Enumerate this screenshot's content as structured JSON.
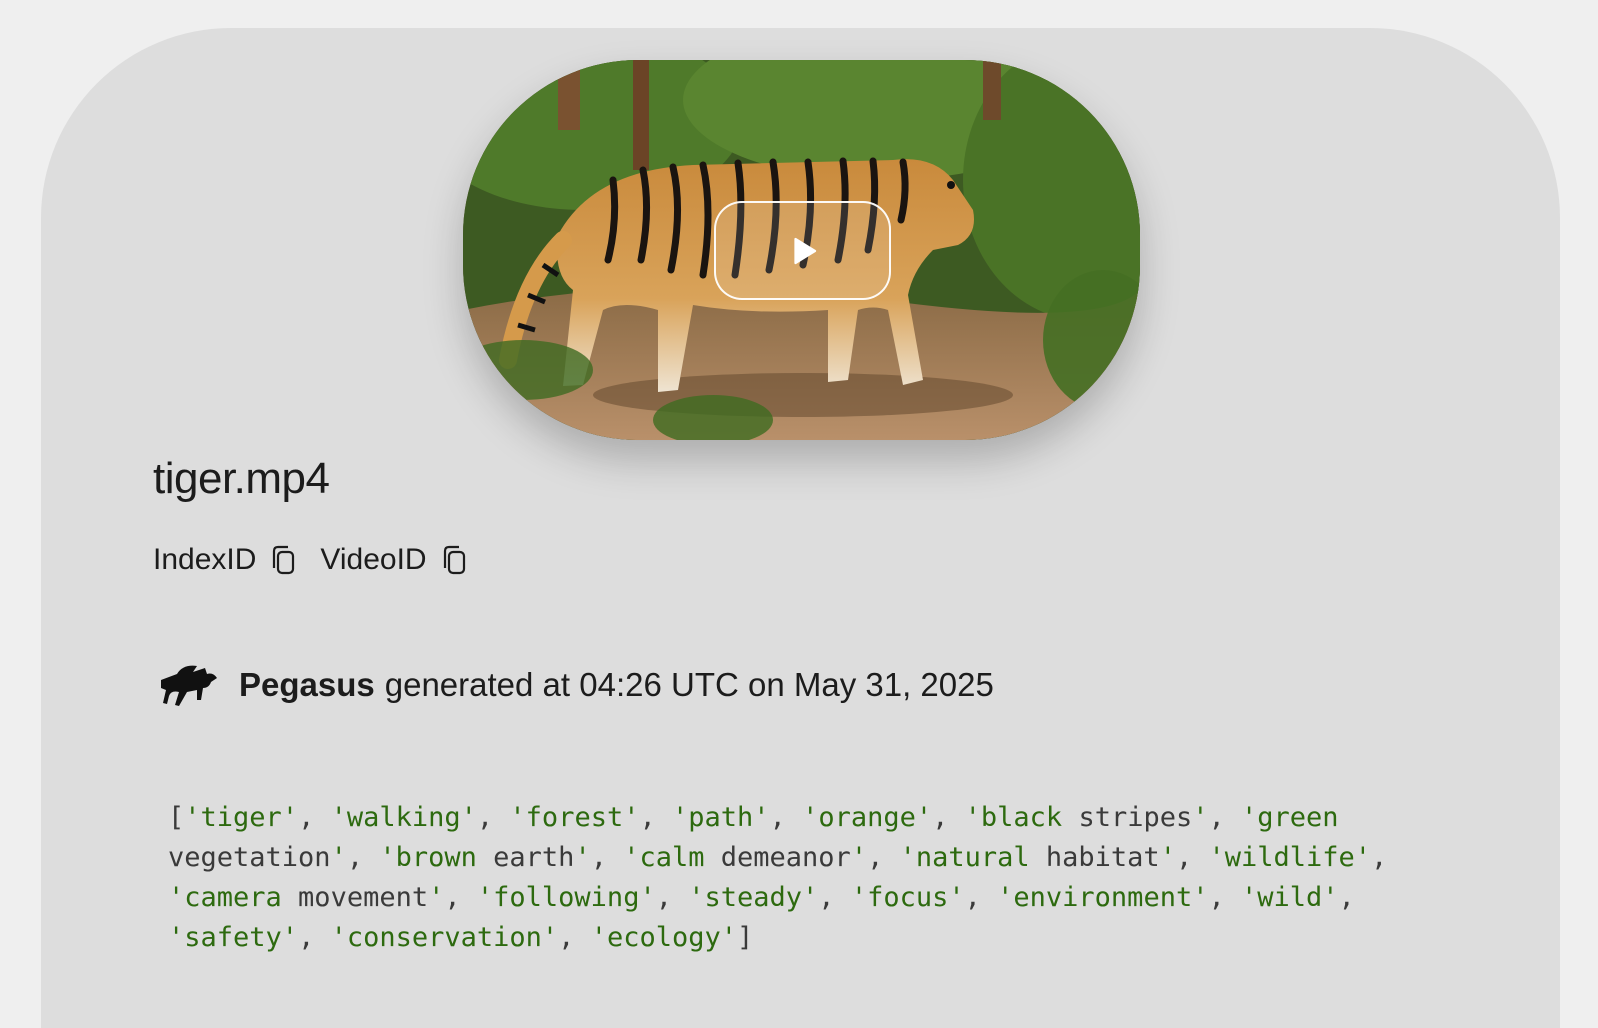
{
  "video": {
    "file_name": "tiger.mp4",
    "thumbnail_description_icon": "tiger-thumbnail",
    "play_icon": "play-icon"
  },
  "ids": {
    "index_label": "IndexID",
    "video_label": "VideoID",
    "copy_icon": "copy-icon"
  },
  "generation": {
    "model": "Pegasus",
    "text": "generated at 04:26 UTC on May 31, 2025",
    "logo_icon": "pegasus-logo-icon"
  },
  "tags": [
    "tiger",
    "walking",
    "forest",
    "path",
    "orange",
    "black stripes",
    "green vegetation",
    "brown earth",
    "calm demeanor",
    "natural habitat",
    "wildlife",
    "camera movement",
    "following",
    "steady",
    "focus",
    "environment",
    "wild",
    "safety",
    "conservation",
    "ecology"
  ],
  "colors": {
    "page_bg": "#efefef",
    "card_bg": "#dddddd",
    "string_green": "#2d6a0f",
    "code_gray": "#3a3a3a"
  }
}
